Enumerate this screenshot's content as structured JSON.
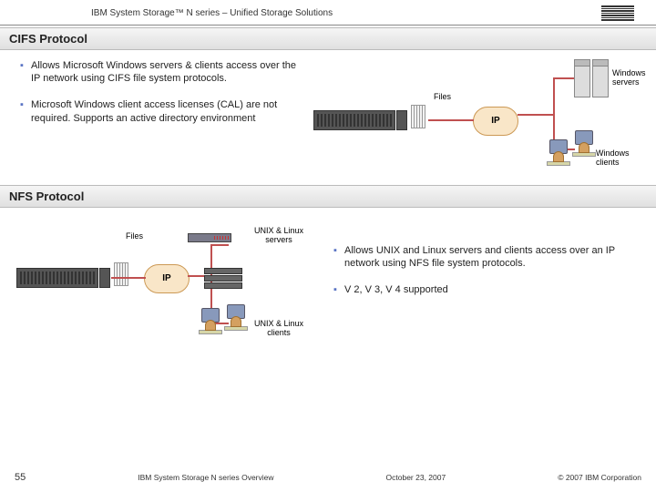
{
  "header": {
    "subtitle": "IBM System Storage™ N series – Unified Storage Solutions"
  },
  "sections": {
    "cifs": {
      "title": "CIFS Protocol",
      "bullets": [
        "Allows Microsoft Windows servers & clients access over the IP network using CIFS file system protocols.",
        "Microsoft Windows client access licenses (CAL) are not required.  Supports an active directory environment"
      ],
      "labels": {
        "files": "Files",
        "ip": "IP",
        "servers": "Windows servers",
        "clients": "Windows clients"
      }
    },
    "nfs": {
      "title": "NFS  Protocol",
      "bullets": [
        "Allows UNIX and Linux servers and clients access over an IP network using NFS file system protocols.",
        "V 2, V 3, V 4 supported"
      ],
      "labels": {
        "files": "Files",
        "ip": "IP",
        "servers": "UNIX & Linux servers",
        "clients": "UNIX & Linux clients"
      }
    }
  },
  "footer": {
    "page": "55",
    "doc": "IBM System Storage N series Overview",
    "date": "October 23, 2007",
    "copyright": "© 2007 IBM Corporation"
  }
}
